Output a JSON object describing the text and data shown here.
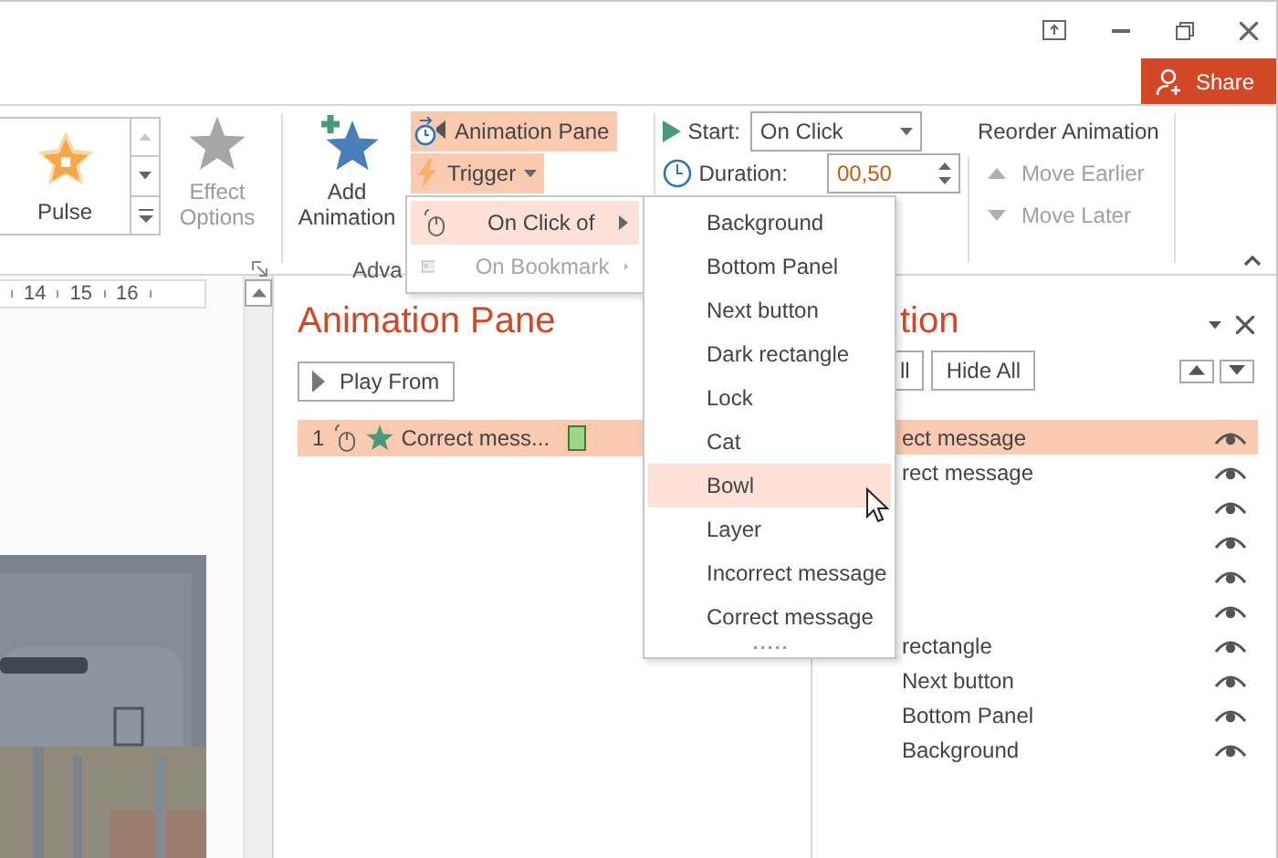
{
  "share_button": {
    "label": "Share"
  },
  "ribbon": {
    "gallery": {
      "items": [
        {
          "label": "Pulse"
        }
      ]
    },
    "effect_options": {
      "label": "Effect Options",
      "disabled": true
    },
    "add_animation": {
      "label": "Add Animation"
    },
    "animation_pane_button": {
      "label": "Animation Pane",
      "active": true
    },
    "trigger_button": {
      "label": "Trigger",
      "active": true
    },
    "group_label": "Adva",
    "start": {
      "label": "Start:",
      "value": "On Click"
    },
    "duration": {
      "label": "Duration:",
      "value": "00,50"
    },
    "reorder": {
      "title": "Reorder Animation",
      "buttons": [
        {
          "label": "Move Earlier",
          "disabled": true
        },
        {
          "label": "Move Later",
          "disabled": true
        }
      ]
    }
  },
  "trigger_menu": {
    "items": [
      {
        "label": "On Click of",
        "selected": true,
        "disabled": false
      },
      {
        "label": "On Bookmark",
        "selected": false,
        "disabled": true
      }
    ]
  },
  "object_menu": {
    "items": [
      {
        "label": "Background",
        "selected": false
      },
      {
        "label": "Bottom Panel",
        "selected": false
      },
      {
        "label": "Next button",
        "selected": false
      },
      {
        "label": "Dark rectangle",
        "selected": false
      },
      {
        "label": "Lock",
        "selected": false
      },
      {
        "label": "Cat",
        "selected": false
      },
      {
        "label": "Bowl",
        "selected": true
      },
      {
        "label": "Layer",
        "selected": false
      },
      {
        "label": "Incorrect message",
        "selected": false
      },
      {
        "label": "Correct message",
        "selected": false
      }
    ]
  },
  "slide_area": {
    "ruler": [
      "14",
      "15",
      "16"
    ]
  },
  "animation_pane": {
    "title": "Animation Pane",
    "play_button": "Play From",
    "items": [
      {
        "number": "1",
        "label": "Correct mess...",
        "selected": true
      }
    ]
  },
  "selection_pane": {
    "title": "tion",
    "show_all": "ll",
    "hide_all": "Hide All",
    "items": [
      {
        "label": "ect message",
        "selected": true,
        "visible": true
      },
      {
        "label": "rect message",
        "selected": false,
        "visible": true
      },
      {
        "selected": false,
        "visible": true
      },
      {
        "selected": false,
        "visible": true
      },
      {
        "selected": false,
        "visible": true
      },
      {
        "selected": false,
        "visible": true
      },
      {
        "label": "rectangle",
        "selected": false,
        "visible": true
      },
      {
        "label": "Next button",
        "selected": false,
        "visible": true
      },
      {
        "label": "Bottom Panel",
        "selected": false,
        "visible": true
      },
      {
        "label": "Background",
        "selected": false,
        "visible": true
      }
    ]
  }
}
